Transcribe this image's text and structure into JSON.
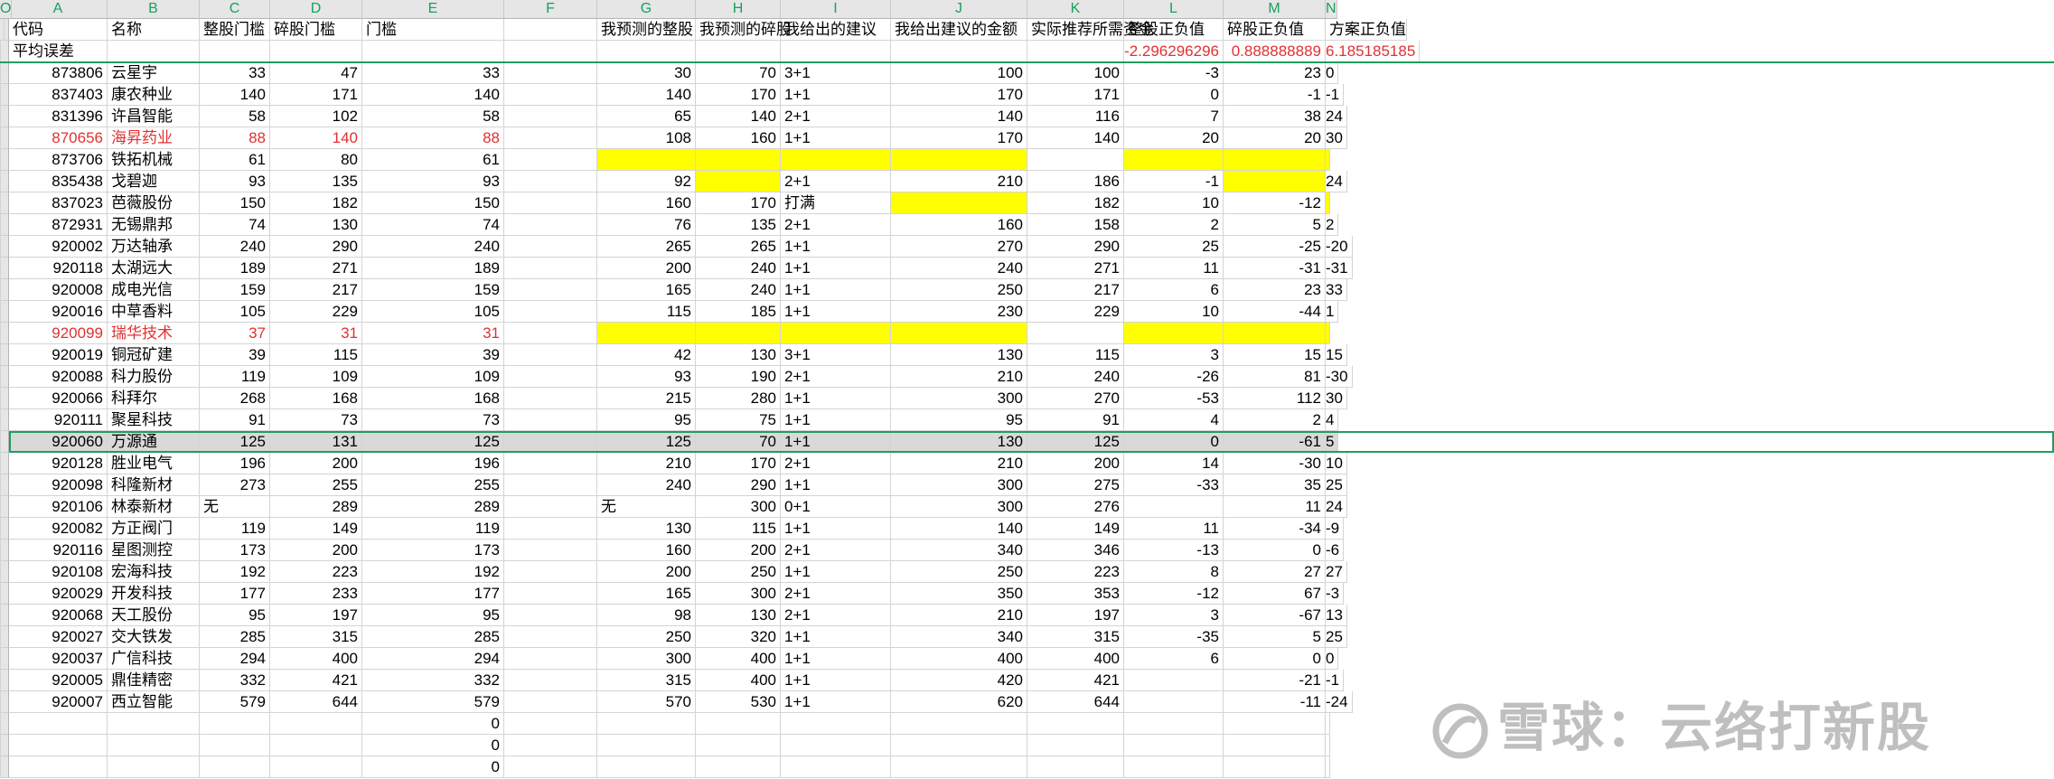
{
  "columns": [
    "A",
    "B",
    "C",
    "D",
    "E",
    "F",
    "G",
    "H",
    "I",
    "J",
    "K",
    "L",
    "M",
    "N",
    "O"
  ],
  "header_row": [
    "代码",
    "名称",
    "整股门槛",
    "碎股门槛",
    "门槛",
    "",
    "我预测的整股",
    "我预测的碎股",
    "我给出的建议",
    "我给出建议的金额",
    "实际推荐所需资金",
    "整股正负值",
    "碎股正负值",
    "方案正负值",
    ""
  ],
  "avg_row": {
    "label": "平均误差",
    "L": "-2.296296296",
    "M": "0.888888889",
    "N": "6.185185185"
  },
  "rows": [
    {
      "A": "873806",
      "B": "云星宇",
      "C": "33",
      "D": "47",
      "E": "33",
      "G": "30",
      "H": "70",
      "I": "3+1",
      "J": "100",
      "K": "100",
      "L": "-3",
      "M": "23",
      "N": "0"
    },
    {
      "A": "837403",
      "B": "康农种业",
      "C": "140",
      "D": "171",
      "E": "140",
      "G": "140",
      "H": "170",
      "I": "1+1",
      "J": "170",
      "K": "171",
      "L": "0",
      "M": "-1",
      "N": "-1"
    },
    {
      "A": "831396",
      "B": "许昌智能",
      "C": "58",
      "D": "102",
      "E": "58",
      "G": "65",
      "H": "140",
      "I": "2+1",
      "J": "140",
      "K": "116",
      "L": "7",
      "M": "38",
      "N": "24"
    },
    {
      "A": "870656",
      "B": "海昇药业",
      "C": "88",
      "D": "140",
      "E": "88",
      "G": "108",
      "H": "160",
      "I": "1+1",
      "J": "170",
      "K": "140",
      "L": "20",
      "M": "20",
      "N": "30",
      "red": true
    },
    {
      "A": "873706",
      "B": "铁拓机械",
      "C": "61",
      "D": "80",
      "E": "61",
      "G": "",
      "H": "",
      "I": "",
      "J": "",
      "K": "",
      "L": "",
      "M": "",
      "N": "",
      "yellow": [
        "G",
        "H",
        "I",
        "J",
        "L",
        "M",
        "N"
      ]
    },
    {
      "A": "835438",
      "B": "戈碧迦",
      "C": "93",
      "D": "135",
      "E": "93",
      "G": "92",
      "H": "",
      "I": "2+1",
      "J": "210",
      "K": "186",
      "L": "-1",
      "M": "",
      "N": "24",
      "yellow": [
        "H",
        "M"
      ]
    },
    {
      "A": "837023",
      "B": "芭薇股份",
      "C": "150",
      "D": "182",
      "E": "150",
      "G": "160",
      "H": "170",
      "I": "打满",
      "J": "",
      "K": "182",
      "L": "10",
      "M": "-12",
      "N": "",
      "yellow": [
        "J",
        "N"
      ]
    },
    {
      "A": "872931",
      "B": "无锡鼎邦",
      "C": "74",
      "D": "130",
      "E": "74",
      "G": "76",
      "H": "135",
      "I": "2+1",
      "J": "160",
      "K": "158",
      "L": "2",
      "M": "5",
      "N": "2"
    },
    {
      "A": "920002",
      "B": "万达轴承",
      "C": "240",
      "D": "290",
      "E": "240",
      "G": "265",
      "H": "265",
      "I": "1+1",
      "J": "270",
      "K": "290",
      "L": "25",
      "M": "-25",
      "N": "-20"
    },
    {
      "A": "920118",
      "B": "太湖远大",
      "C": "189",
      "D": "271",
      "E": "189",
      "G": "200",
      "H": "240",
      "I": "1+1",
      "J": "240",
      "K": "271",
      "L": "11",
      "M": "-31",
      "N": "-31"
    },
    {
      "A": "920008",
      "B": "成电光信",
      "C": "159",
      "D": "217",
      "E": "159",
      "G": "165",
      "H": "240",
      "I": "1+1",
      "J": "250",
      "K": "217",
      "L": "6",
      "M": "23",
      "N": "33"
    },
    {
      "A": "920016",
      "B": "中草香料",
      "C": "105",
      "D": "229",
      "E": "105",
      "G": "115",
      "H": "185",
      "I": "1+1",
      "J": "230",
      "K": "229",
      "L": "10",
      "M": "-44",
      "N": "1"
    },
    {
      "A": "920099",
      "B": "瑞华技术",
      "C": "37",
      "D": "31",
      "E": "31",
      "G": "",
      "H": "",
      "I": "",
      "J": "",
      "K": "",
      "L": "",
      "M": "",
      "N": "",
      "red": true,
      "yellow": [
        "G",
        "H",
        "I",
        "J",
        "L",
        "M",
        "N"
      ]
    },
    {
      "A": "920019",
      "B": "铜冠矿建",
      "C": "39",
      "D": "115",
      "E": "39",
      "G": "42",
      "H": "130",
      "I": "3+1",
      "J": "130",
      "K": "115",
      "L": "3",
      "M": "15",
      "N": "15"
    },
    {
      "A": "920088",
      "B": "科力股份",
      "C": "119",
      "D": "109",
      "E": "109",
      "G": "93",
      "H": "190",
      "I": "2+1",
      "J": "210",
      "K": "240",
      "L": "-26",
      "M": "81",
      "N": "-30"
    },
    {
      "A": "920066",
      "B": "科拜尔",
      "C": "268",
      "D": "168",
      "E": "168",
      "G": "215",
      "H": "280",
      "I": "1+1",
      "J": "300",
      "K": "270",
      "L": "-53",
      "M": "112",
      "N": "30"
    },
    {
      "A": "920111",
      "B": "聚星科技",
      "C": "91",
      "D": "73",
      "E": "73",
      "G": "95",
      "H": "75",
      "I": "1+1",
      "J": "95",
      "K": "91",
      "L": "4",
      "M": "2",
      "N": "4"
    },
    {
      "A": "920060",
      "B": "万源通",
      "C": "125",
      "D": "131",
      "E": "125",
      "G": "125",
      "H": "70",
      "I": "1+1",
      "J": "130",
      "K": "125",
      "L": "0",
      "M": "-61",
      "N": "5",
      "selected": true
    },
    {
      "A": "920128",
      "B": "胜业电气",
      "C": "196",
      "D": "200",
      "E": "196",
      "G": "210",
      "H": "170",
      "I": "2+1",
      "J": "210",
      "K": "200",
      "L": "14",
      "M": "-30",
      "N": "10"
    },
    {
      "A": "920098",
      "B": "科隆新材",
      "C": "273",
      "D": "255",
      "E": "255",
      "G": "240",
      "H": "290",
      "I": "1+1",
      "J": "300",
      "K": "275",
      "L": "-33",
      "M": "35",
      "N": "25"
    },
    {
      "A": "920106",
      "B": "林泰新材",
      "C": "无",
      "D": "289",
      "E": "289",
      "G": "无",
      "H": "300",
      "I": "0+1",
      "J": "300",
      "K": "276",
      "L": "",
      "M": "11",
      "N": "24",
      "textC": true,
      "textG": true
    },
    {
      "A": "920082",
      "B": "方正阀门",
      "C": "119",
      "D": "149",
      "E": "119",
      "G": "130",
      "H": "115",
      "I": "1+1",
      "J": "140",
      "K": "149",
      "L": "11",
      "M": "-34",
      "N": "-9"
    },
    {
      "A": "920116",
      "B": "星图测控",
      "C": "173",
      "D": "200",
      "E": "173",
      "G": "160",
      "H": "200",
      "I": "2+1",
      "J": "340",
      "K": "346",
      "L": "-13",
      "M": "0",
      "N": "-6"
    },
    {
      "A": "920108",
      "B": "宏海科技",
      "C": "192",
      "D": "223",
      "E": "192",
      "G": "200",
      "H": "250",
      "I": "1+1",
      "J": "250",
      "K": "223",
      "L": "8",
      "M": "27",
      "N": "27"
    },
    {
      "A": "920029",
      "B": "开发科技",
      "C": "177",
      "D": "233",
      "E": "177",
      "G": "165",
      "H": "300",
      "I": "2+1",
      "J": "350",
      "K": "353",
      "L": "-12",
      "M": "67",
      "N": "-3"
    },
    {
      "A": "920068",
      "B": "天工股份",
      "C": "95",
      "D": "197",
      "E": "95",
      "G": "98",
      "H": "130",
      "I": "2+1",
      "J": "210",
      "K": "197",
      "L": "3",
      "M": "-67",
      "N": "13"
    },
    {
      "A": "920027",
      "B": "交大铁发",
      "C": "285",
      "D": "315",
      "E": "285",
      "G": "250",
      "H": "320",
      "I": "1+1",
      "J": "340",
      "K": "315",
      "L": "-35",
      "M": "5",
      "N": "25"
    },
    {
      "A": "920037",
      "B": "广信科技",
      "C": "294",
      "D": "400",
      "E": "294",
      "G": "300",
      "H": "400",
      "I": "1+1",
      "J": "400",
      "K": "400",
      "L": "6",
      "M": "0",
      "N": "0"
    },
    {
      "A": "920005",
      "B": "鼎佳精密",
      "C": "332",
      "D": "421",
      "E": "332",
      "G": "315",
      "H": "400",
      "I": "1+1",
      "J": "420",
      "K": "421",
      "L": "",
      "M": "-21",
      "N": "-1"
    },
    {
      "A": "920007",
      "B": "西立智能",
      "C": "579",
      "D": "644",
      "E": "579",
      "G": "570",
      "H": "530",
      "I": "1+1",
      "J": "620",
      "K": "644",
      "L": "",
      "M": "-11",
      "N": "-24"
    },
    {
      "A": "",
      "B": "",
      "C": "",
      "D": "",
      "E": "0",
      "G": "",
      "H": "",
      "I": "",
      "J": "",
      "K": "",
      "L": "",
      "M": "",
      "N": ""
    },
    {
      "A": "",
      "B": "",
      "C": "",
      "D": "",
      "E": "0",
      "G": "",
      "H": "",
      "I": "",
      "J": "",
      "K": "",
      "L": "",
      "M": "",
      "N": ""
    },
    {
      "A": "",
      "B": "",
      "C": "",
      "D": "",
      "E": "0",
      "G": "",
      "H": "",
      "I": "",
      "J": "",
      "K": "",
      "L": "",
      "M": "",
      "N": ""
    }
  ],
  "watermark": "雪球：云络打新股",
  "colors": {
    "red": "#e03131",
    "yellow": "#ffff00",
    "accent": "#1f9e5e"
  }
}
